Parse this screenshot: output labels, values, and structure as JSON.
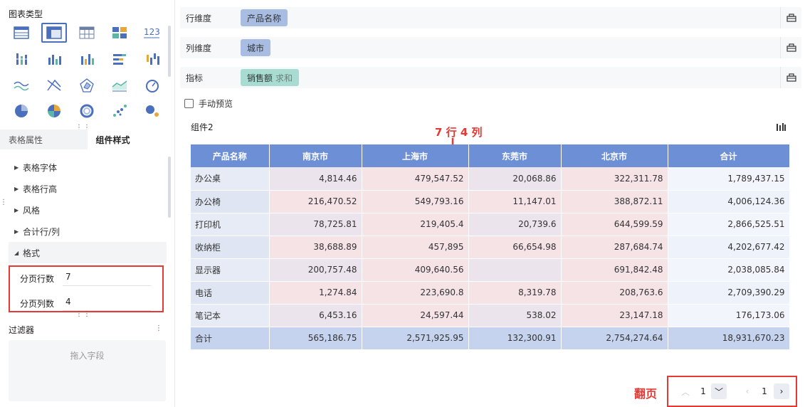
{
  "left_panel": {
    "chart_type_title": "图表类型",
    "chart_icons": [
      "table-icon",
      "cross-table-icon",
      "detail-table-icon",
      "card-icon",
      "kpi-number-icon",
      "dot-bar-icon",
      "column-chart-icon",
      "multi-column-icon",
      "stacked-bar-icon",
      "waterfall-icon",
      "line-chart-icon",
      "radar-x-icon",
      "radar-icon",
      "area-line-icon",
      "gauge-icon",
      "pie-icon",
      "quadrant-pie-icon",
      "ring-icon",
      "scatter-icon",
      "bubble-icon"
    ],
    "tabs": [
      "表格属性",
      "组件样式"
    ],
    "active_tab": "组件样式",
    "tree_items": [
      "表格字体",
      "表格行高",
      "风格",
      "合计行/列",
      "格式"
    ],
    "format_fields": [
      {
        "label": "分页行数",
        "value": "7"
      },
      {
        "label": "分页列数",
        "value": "4"
      }
    ],
    "filter_title": "过滤器",
    "filter_drop_hint": "拖入字段"
  },
  "fields": {
    "row_dim_label": "行维度",
    "row_dim_chip": "产品名称",
    "col_dim_label": "列维度",
    "col_dim_chip": "城市",
    "measure_label": "指标",
    "measure_chip": "销售额",
    "measure_agg": "求和"
  },
  "manual_preview_label": "手动预览",
  "component_title": "组件2",
  "annotation_rows_cols": "7 行 4 列",
  "annotation_paging": "翻页",
  "table": {
    "headers": [
      "产品名称",
      "南京市",
      "上海市",
      "东莞市",
      "北京市",
      "合计"
    ],
    "rows": [
      [
        "办公桌",
        "4,814.46",
        "479,547.52",
        "20,068.86",
        "322,311.78",
        "1,789,437.15"
      ],
      [
        "办公椅",
        "216,470.52",
        "549,793.16",
        "11,147.01",
        "388,872.11",
        "4,006,124.36"
      ],
      [
        "打印机",
        "78,725.81",
        "219,405.4",
        "20,739.6",
        "644,599.59",
        "2,866,525.51"
      ],
      [
        "收纳柜",
        "38,688.89",
        "457,895",
        "66,654.98",
        "287,684.74",
        "4,202,677.42"
      ],
      [
        "显示器",
        "200,757.48",
        "409,640.56",
        "",
        "691,842.48",
        "2,038,085.84"
      ],
      [
        "电话",
        "1,274.84",
        "223,690.8",
        "8,319.78",
        "208,763.6",
        "2,709,390.29"
      ],
      [
        "笔记本",
        "6,453.16",
        "24,597.44",
        "538.02",
        "23,147.18",
        "176,173.06"
      ]
    ],
    "total_row": [
      "合计",
      "565,186.75",
      "2,571,925.95",
      "132,300.91",
      "2,754,274.64",
      "18,931,670.23"
    ]
  },
  "pager": {
    "row_page": "1",
    "col_page": "1"
  },
  "colors": {
    "header_bg": "#6d8fd6",
    "annotation_red": "#e53935",
    "chip_blue": "#a9bde3",
    "chip_teal": "#a8dcd2"
  }
}
